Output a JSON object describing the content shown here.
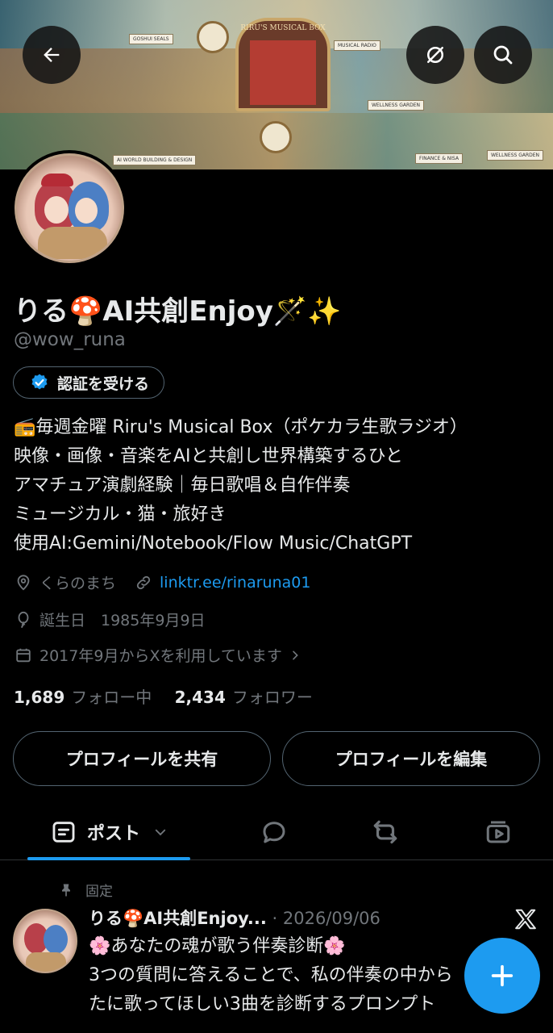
{
  "banner": {
    "stage_title": "RIRU'S MUSICAL BOX",
    "labels": [
      "GOSHUI SEALS",
      "MUSICAL RADIO",
      "WELLNESS GARDEN",
      "AI WORLD BUILDING & DESIGN",
      "FINANCE & NISA",
      "WELLNESS GARDEN"
    ]
  },
  "header_buttons": {
    "back": "back-arrow-icon",
    "hide": "eye-slash-icon",
    "search": "search-icon"
  },
  "profile": {
    "name": "りる🍄AI共創Enjoy🪄✨",
    "handle": "@wow_runa",
    "verify_label": "認証を受ける",
    "bio": [
      "📻毎週金曜 Riru's Musical Box（ポケカラ生歌ラジオ）",
      "映像・画像・音楽をAIと共創し世界構築するひと",
      "アマチュア演劇経験｜毎日歌唱＆自作伴奏",
      "ミュージカル・猫・旅好き",
      "使用AI:Gemini/Notebook/Flow Music/ChatGPT"
    ],
    "location": "くらのまち",
    "website": "linktr.ee/rinaruna01",
    "birthday": "誕生日　1985年9月9日",
    "joined": "2017年9月からXを利用しています",
    "following_count": "1,689",
    "following_label": "フォロー中",
    "followers_count": "2,434",
    "followers_label": "フォロワー"
  },
  "actions": {
    "share": "プロフィールを共有",
    "edit": "プロフィールを編集"
  },
  "tabs": {
    "posts_label": "ポスト"
  },
  "pinned_post": {
    "pinned_label": "固定",
    "author": "りる🍄AI共創Enjoy...",
    "date": "· 2026/09/06",
    "lines": [
      "🌸あなたの魂が歌う伴奏診断🌸",
      "3つの質問に答えることで、私の伴奏の中から",
      "たに歌ってほしい3曲を診断するプロンプト"
    ]
  },
  "colors": {
    "accent": "#1d9bf0",
    "muted": "#71767b",
    "text": "#e7e9ea",
    "border": "#536471",
    "background": "#000000"
  }
}
